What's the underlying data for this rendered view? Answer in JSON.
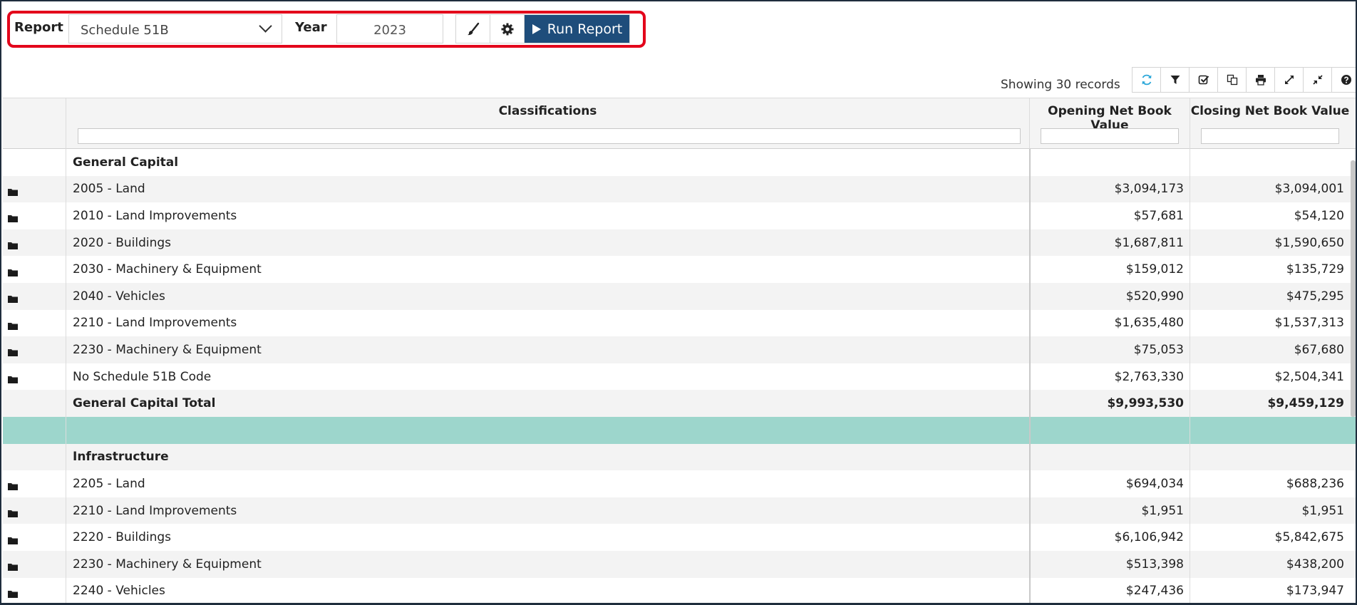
{
  "toolbar": {
    "report_label": "Report",
    "report_value": "Schedule 51B",
    "year_label": "Year",
    "year_value": "2023",
    "run_label": "Run Report"
  },
  "grid": {
    "records_text": "Showing 30 records",
    "columns": [
      "Classifications",
      "Opening Net Book Value",
      "Closing Net Book Value"
    ],
    "rows": [
      {
        "type": "group",
        "label": "General Capital",
        "open": "",
        "close": ""
      },
      {
        "type": "data",
        "label": "2005 - Land",
        "open": "$3,094,173",
        "close": "$3,094,001"
      },
      {
        "type": "data",
        "label": "2010 - Land Improvements",
        "open": "$57,681",
        "close": "$54,120"
      },
      {
        "type": "data",
        "label": "2020 - Buildings",
        "open": "$1,687,811",
        "close": "$1,590,650"
      },
      {
        "type": "data",
        "label": "2030 - Machinery & Equipment",
        "open": "$159,012",
        "close": "$135,729"
      },
      {
        "type": "data",
        "label": "2040 - Vehicles",
        "open": "$520,990",
        "close": "$475,295"
      },
      {
        "type": "data",
        "label": "2210 - Land Improvements",
        "open": "$1,635,480",
        "close": "$1,537,313"
      },
      {
        "type": "data",
        "label": "2230 - Machinery & Equipment",
        "open": "$75,053",
        "close": "$67,680"
      },
      {
        "type": "data",
        "label": "No Schedule 51B Code",
        "open": "$2,763,330",
        "close": "$2,504,341"
      },
      {
        "type": "total",
        "label": "General Capital Total",
        "open": "$9,993,530",
        "close": "$9,459,129"
      },
      {
        "type": "spacer",
        "label": "",
        "open": "",
        "close": ""
      },
      {
        "type": "group",
        "label": "Infrastructure",
        "open": "",
        "close": ""
      },
      {
        "type": "data",
        "label": "2205 - Land",
        "open": "$694,034",
        "close": "$688,236"
      },
      {
        "type": "data",
        "label": "2210 - Land Improvements",
        "open": "$1,951",
        "close": "$1,951"
      },
      {
        "type": "data",
        "label": "2220 - Buildings",
        "open": "$6,106,942",
        "close": "$5,842,675"
      },
      {
        "type": "data",
        "label": "2230 - Machinery & Equipment",
        "open": "$513,398",
        "close": "$438,200"
      },
      {
        "type": "data",
        "label": "2240 - Vehicles",
        "open": "$247,436",
        "close": "$173,947"
      }
    ]
  },
  "icons": {
    "toolbar": [
      "brush-icon",
      "gear-icon",
      "play-icon"
    ],
    "grid_toolbar": [
      "refresh-icon",
      "filter-icon",
      "check-icon",
      "copy-icon",
      "print-icon",
      "expand-icon",
      "collapse-icon",
      "help-icon"
    ],
    "row": "folder-icon"
  },
  "colors": {
    "run_button": "#1e4d7b",
    "highlight_outline": "#e3051b",
    "spacer_row": "#9dd6cc",
    "refresh_icon": "#2aa7d9"
  }
}
